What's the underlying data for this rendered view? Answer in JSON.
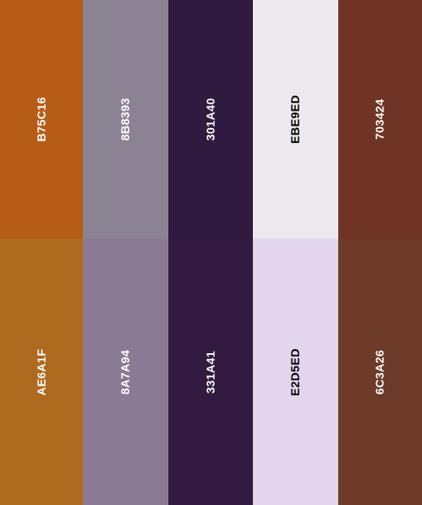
{
  "palette": {
    "top": [
      {
        "code": "B75C16",
        "color": "#B75C16",
        "text": "light"
      },
      {
        "code": "8B8393",
        "color": "#8B8393",
        "text": "light"
      },
      {
        "code": "301A40",
        "color": "#301A40",
        "text": "light"
      },
      {
        "code": "EBE9ED",
        "color": "#EBE9ED",
        "text": "dark"
      },
      {
        "code": "703424",
        "color": "#703424",
        "text": "light"
      }
    ],
    "bottom": [
      {
        "code": "AE6A1F",
        "color": "#AE6A1F",
        "text": "light"
      },
      {
        "code": "8A7A94",
        "color": "#8A7A94",
        "text": "light"
      },
      {
        "code": "331A41",
        "color": "#331A41",
        "text": "light"
      },
      {
        "code": "E2D5ED",
        "color": "#E2D5ED",
        "text": "dark"
      },
      {
        "code": "6C3A26",
        "color": "#6C3A26",
        "text": "light"
      }
    ]
  }
}
